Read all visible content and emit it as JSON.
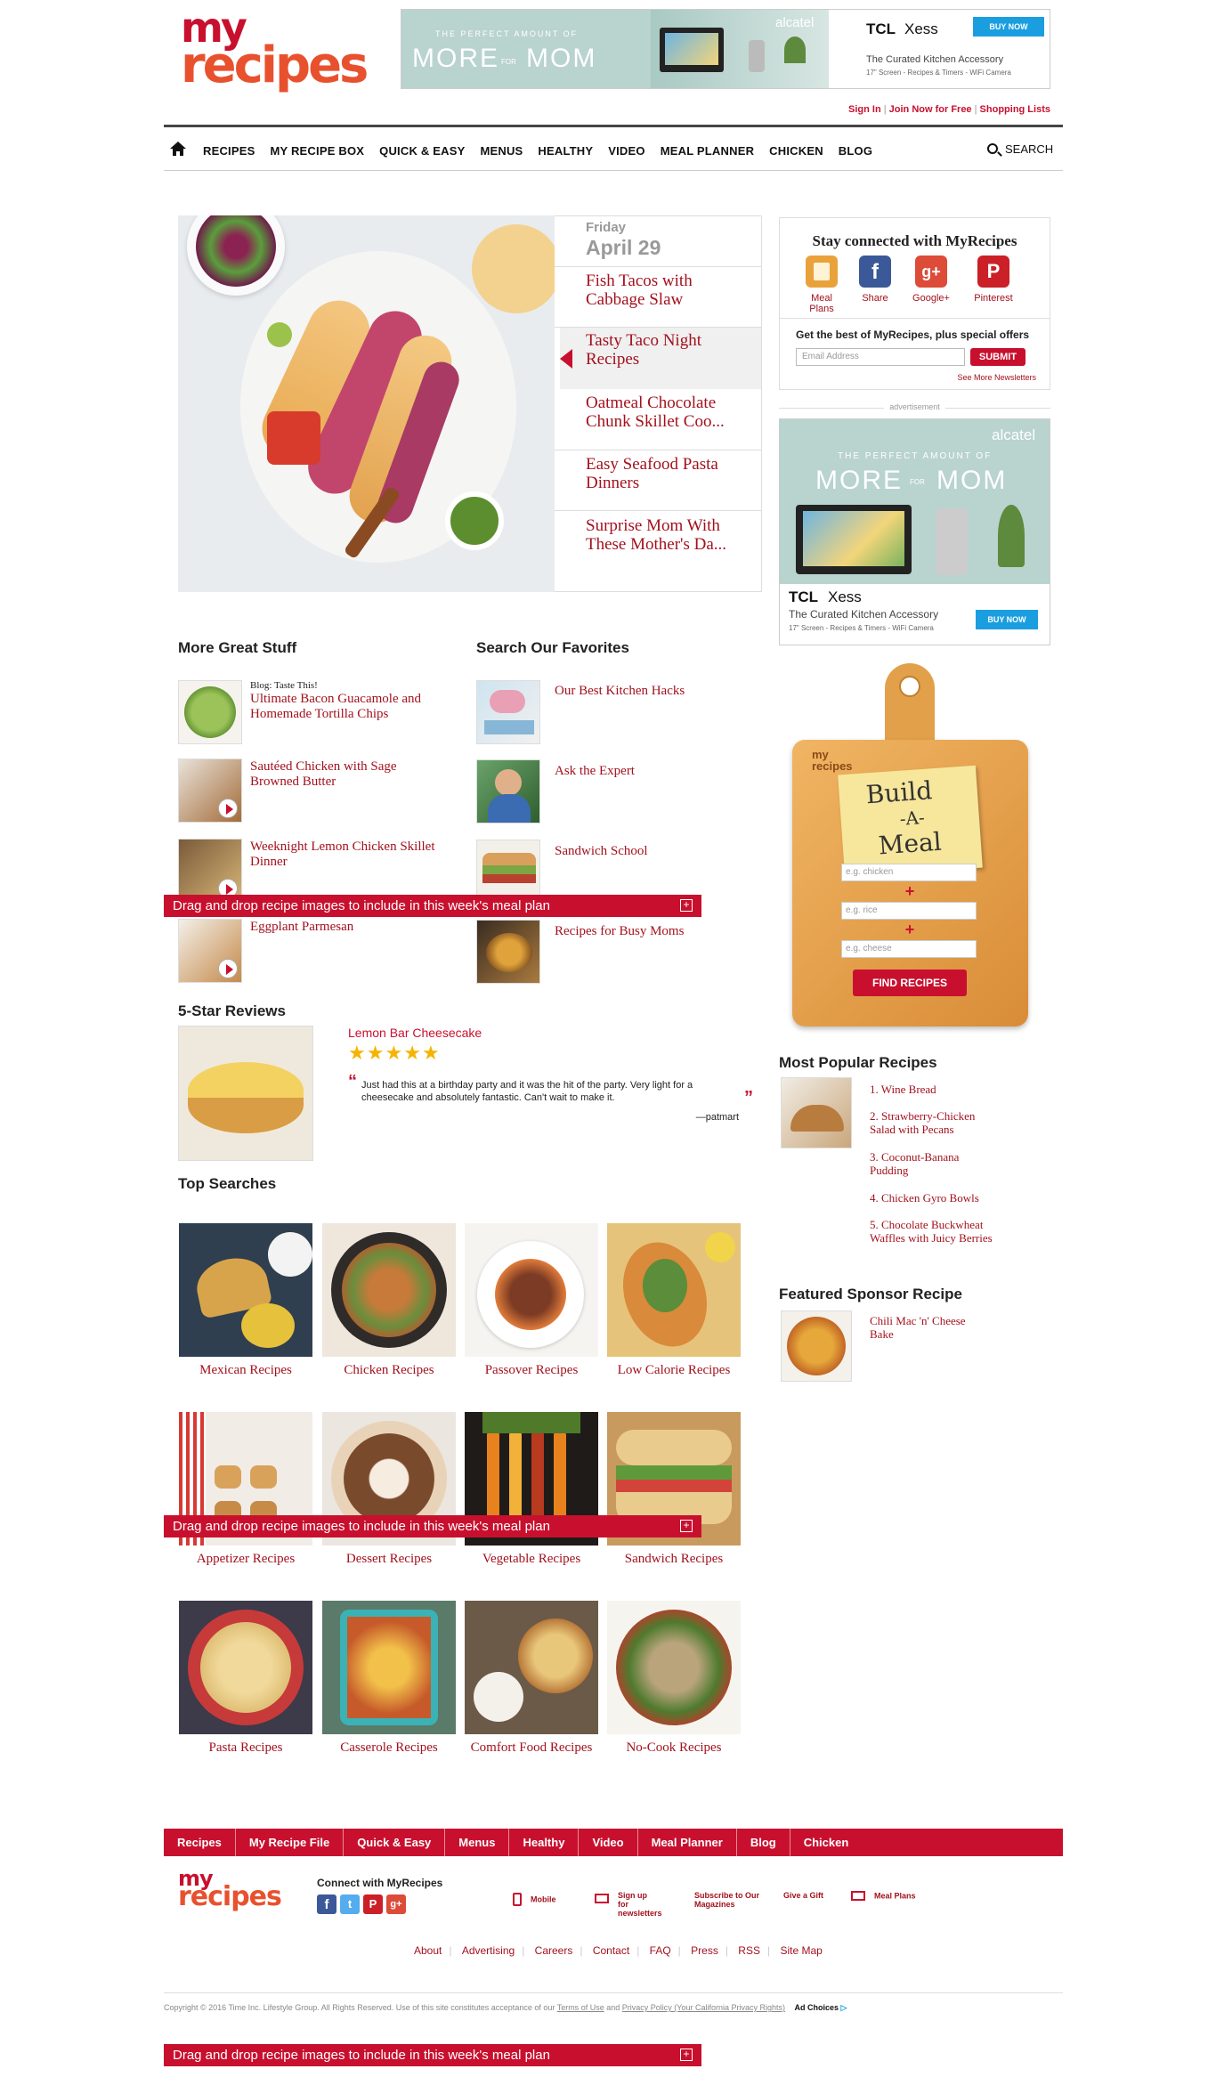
{
  "header": {
    "logo_top": "my",
    "logo_bottom": "recipes",
    "ad": {
      "tagline_small": "THE PERFECT AMOUNT OF",
      "tagline_big_1": "MORE",
      "tagline_for": "FOR",
      "tagline_big_2": "MOM",
      "brand_alcatel": "alcatel",
      "brand_tcl": "TCL",
      "product": "Xess",
      "button": "BUY NOW",
      "line1": "The Curated Kitchen Accessory",
      "line2": "17\" Screen - Recipes & Timers - WiFi Camera"
    },
    "user_links": [
      "Sign In",
      "Join Now for Free",
      "Shopping Lists"
    ]
  },
  "nav": {
    "items": [
      "RECIPES",
      "MY RECIPE BOX",
      "QUICK & EASY",
      "MENUS",
      "HEALTHY",
      "VIDEO",
      "MEAL PLANNER",
      "CHICKEN",
      "BLOG"
    ],
    "search": "SEARCH"
  },
  "hero": {
    "day": "Friday",
    "date": "April 29",
    "items": [
      "Fish Tacos with Cabbage Slaw",
      "Tasty Taco Night Recipes",
      "Oatmeal Chocolate Chunk Skillet Coo...",
      "Easy Seafood Pasta Dinners",
      "Surprise Mom With These Mother's Da..."
    ],
    "active_index": 1
  },
  "social": {
    "title": "Stay connected with MyRecipes",
    "icons": [
      {
        "label": "Meal Plans",
        "icon": "book-icon",
        "color": "#e9a23b"
      },
      {
        "label": "Share",
        "icon": "facebook-icon",
        "color": "#3b5998"
      },
      {
        "label": "Google+",
        "icon": "googleplus-icon",
        "color": "#dd4b39"
      },
      {
        "label": "Pinterest",
        "icon": "pinterest-icon",
        "color": "#cb2027"
      }
    ],
    "newsletter_text": "Get the best of MyRecipes, plus special offers",
    "email_placeholder": "Email Address",
    "submit": "SUBMIT",
    "see_more": "See More Newsletters"
  },
  "advertisement_label": "advertisement",
  "more_great_stuff": {
    "title": "More Great Stuff",
    "items": [
      {
        "eyebrow": "Blog: Taste This!",
        "label": "Ultimate Bacon Guacamole and Homemade Tortilla Chips"
      },
      {
        "eyebrow": "",
        "label": "Sautéed Chicken with Sage Browned Butter"
      },
      {
        "eyebrow": "",
        "label": "Weeknight Lemon Chicken Skillet Dinner"
      },
      {
        "eyebrow": "",
        "label": "Eggplant Parmesan"
      }
    ]
  },
  "search_favorites": {
    "title": "Search Our Favorites",
    "items": [
      "Our Best Kitchen Hacks",
      "Ask the Expert",
      "Sandwich School",
      "Recipes for Busy Moms"
    ]
  },
  "drag_bar": {
    "text": "Drag and drop recipe images to include in this week's meal plan",
    "plus": "+"
  },
  "reviews": {
    "title": "5-Star Reviews",
    "recipe": "Lemon Bar Cheesecake",
    "stars": 5,
    "quote": "Just had this at a birthday party and it was the hit of the party. Very light for a cheesecake and absolutely fantastic. Can't wait to make it.",
    "author": "—patmart"
  },
  "build_meal": {
    "logo": "my recipes",
    "title_1": "Build",
    "title_2": "-A-",
    "title_3": "Meal",
    "placeholders": [
      "e.g. chicken",
      "e.g. rice",
      "e.g. cheese"
    ],
    "plus": "+",
    "button": "FIND RECIPES"
  },
  "popular": {
    "title": "Most Popular Recipes",
    "items": [
      "1. Wine Bread",
      "2. Strawberry-Chicken Salad with Pecans",
      "3. Coconut-Banana Pudding",
      "4. Chicken Gyro Bowls",
      "5. Chocolate Buckwheat Waffles with Juicy Berries"
    ]
  },
  "sponsor": {
    "title": "Featured Sponsor Recipe",
    "item": "Chili Mac 'n' Cheese Bake"
  },
  "top_searches": {
    "title": "Top Searches",
    "items": [
      "Mexican Recipes",
      "Chicken Recipes",
      "Passover Recipes",
      "Low Calorie Recipes",
      "Appetizer Recipes",
      "Dessert Recipes",
      "Vegetable Recipes",
      "Sandwich Recipes",
      "Pasta Recipes",
      "Casserole Recipes",
      "Comfort Food Recipes",
      "No-Cook Recipes"
    ]
  },
  "footer": {
    "nav": [
      "Recipes",
      "My Recipe File",
      "Quick & Easy",
      "Menus",
      "Healthy",
      "Video",
      "Meal Planner",
      "Blog",
      "Chicken"
    ],
    "connect": "Connect with MyRecipes",
    "links": [
      {
        "label": "Mobile",
        "icon": "mobile-icon"
      },
      {
        "label": "Sign up for newsletters",
        "icon": "mail-icon"
      },
      {
        "label": "Subscribe to Our Magazines",
        "icon": ""
      },
      {
        "label": "Give a Gift",
        "icon": ""
      },
      {
        "label": "Meal Plans",
        "icon": "mail-icon"
      }
    ],
    "bottom_links": [
      "About",
      "Advertising",
      "Careers",
      "Contact",
      "FAQ",
      "Press",
      "RSS",
      "Site Map"
    ],
    "copyright": "Copyright © 2016 Time Inc. Lifestyle Group. All Rights Reserved. Use of this site constitutes acceptance of our",
    "terms": "Terms of Use",
    "and": "and",
    "privacy": "Privacy Policy (Your California Privacy Rights)",
    "ad_choices": "Ad Choices"
  }
}
